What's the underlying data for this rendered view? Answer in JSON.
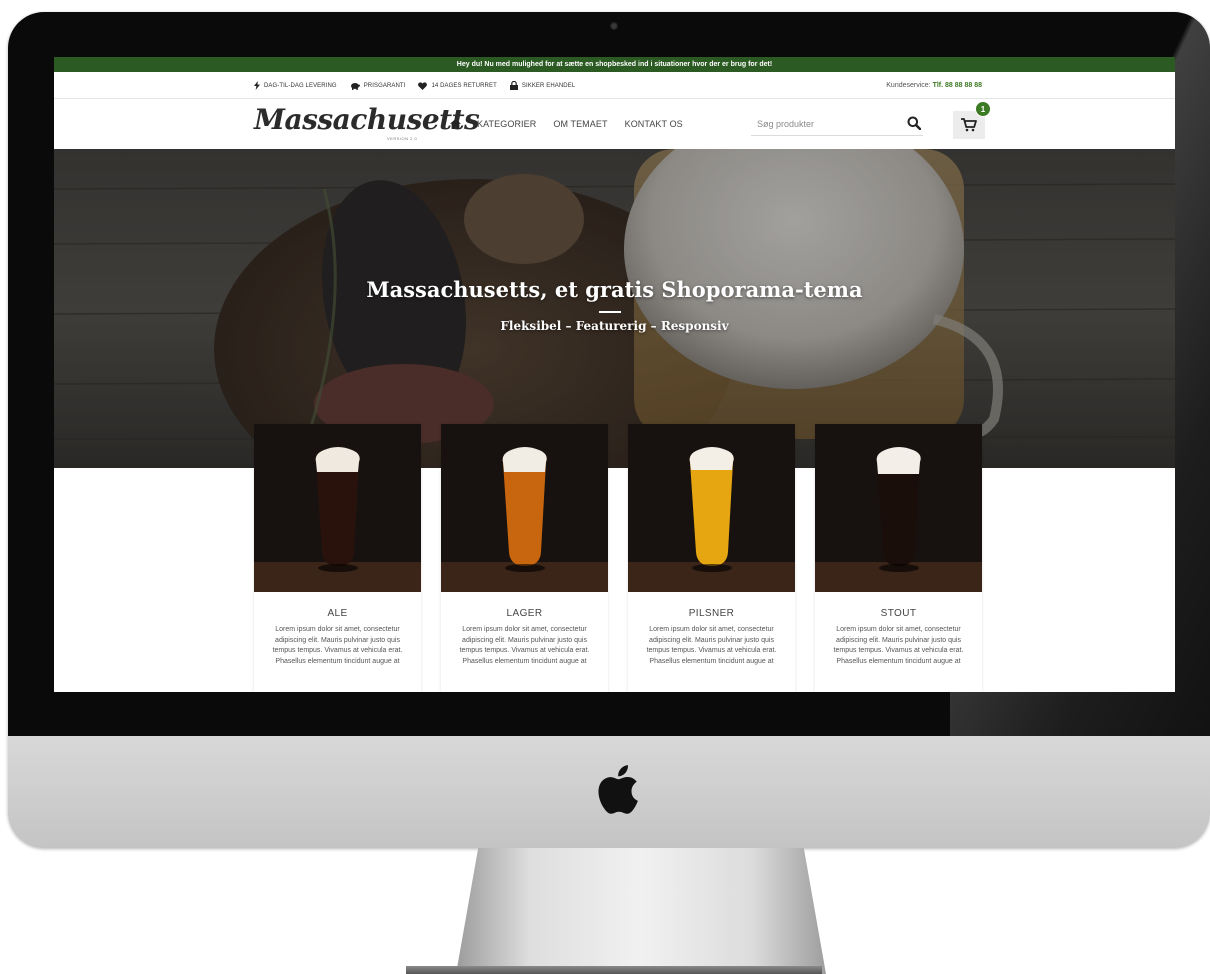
{
  "promo_bar": {
    "text": "Hey du! Nu med mulighed for at sætte en shopbesked ind i situationer hvor der er brug for det!"
  },
  "usp_bar": {
    "items": [
      {
        "label": "DAG-TIL-DAG LEVERING",
        "icon": "lightning-icon"
      },
      {
        "label": "PRISGARANTI",
        "icon": "piggy-bank-icon"
      },
      {
        "label": "14 DAGES RETURRET",
        "icon": "heart-icon"
      },
      {
        "label": "SIKKER EHANDEL",
        "icon": "lock-icon"
      }
    ],
    "customer_service_label": "Kundeservice:",
    "customer_service_phone": "Tlf. 88 88 88 88"
  },
  "header": {
    "logo_text": "Massachusetts",
    "logo_subtext": "VERSION 2.0",
    "nav": [
      {
        "label": "KATEGORIER"
      },
      {
        "label": "OM TEMAET"
      },
      {
        "label": "KONTAKT OS"
      }
    ],
    "search_placeholder": "Søg produkter",
    "cart_count": "1"
  },
  "hero": {
    "title": "Massachusetts, et gratis Shoporama-tema",
    "subtitle": "Fleksibel – Featurerig – Responsiv"
  },
  "products": [
    {
      "name": "ALE",
      "description": "Lorem ipsum dolor sit amet, consectetur adipiscing elit. Mauris pulvinar justo quis tempus tempus. Vivamus at vehicula erat. Phasellus elementum tincidunt augue at",
      "beer_color": "#2a120c"
    },
    {
      "name": "LAGER",
      "description": "Lorem ipsum dolor sit amet, consectetur adipiscing elit. Mauris pulvinar justo quis tempus tempus. Vivamus at vehicula erat. Phasellus elementum tincidunt augue at",
      "beer_color": "#c8660f"
    },
    {
      "name": "PILSNER",
      "description": "Lorem ipsum dolor sit amet, consectetur adipiscing elit. Mauris pulvinar justo quis tempus tempus. Vivamus at vehicula erat. Phasellus elementum tincidunt augue at",
      "beer_color": "#e6a612"
    },
    {
      "name": "STOUT",
      "description": "Lorem ipsum dolor sit amet, consectetur adipiscing elit. Mauris pulvinar justo quis tempus tempus. Vivamus at vehicula erat. Phasellus elementum tincidunt augue at",
      "beer_color": "#1a0e0a"
    }
  ],
  "colors": {
    "brand_green": "#3d7a24",
    "promo_green": "#2c5a23"
  }
}
